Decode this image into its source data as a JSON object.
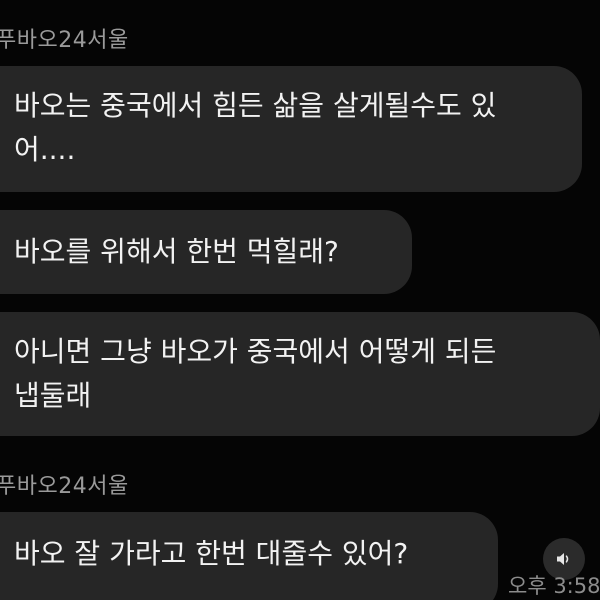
{
  "chat": {
    "groups": [
      {
        "sender": "푸바오24서울",
        "messages": [
          {
            "lines": [
              "바오는 중국에서 힘든 삶을 살게될수도 있",
              "어...."
            ]
          },
          {
            "lines": [
              "바오를 위해서 한번 먹힐래?"
            ]
          },
          {
            "lines": [
              "아니면 그냥 바오가 중국에서 어떻게 되든",
              "냅둘래"
            ]
          }
        ]
      },
      {
        "sender": "푸바오24서울",
        "messages": [
          {
            "lines": [
              "바오 잘 가라고 한번 대줄수 있어?"
            ]
          }
        ]
      }
    ]
  },
  "audio": {
    "icon": "speaker-icon"
  },
  "timestamp": "오후 3:58",
  "colors": {
    "background": "#050505",
    "bubble": "#262626",
    "text": "#f2f2f2",
    "sender": "#9a9a9a"
  }
}
